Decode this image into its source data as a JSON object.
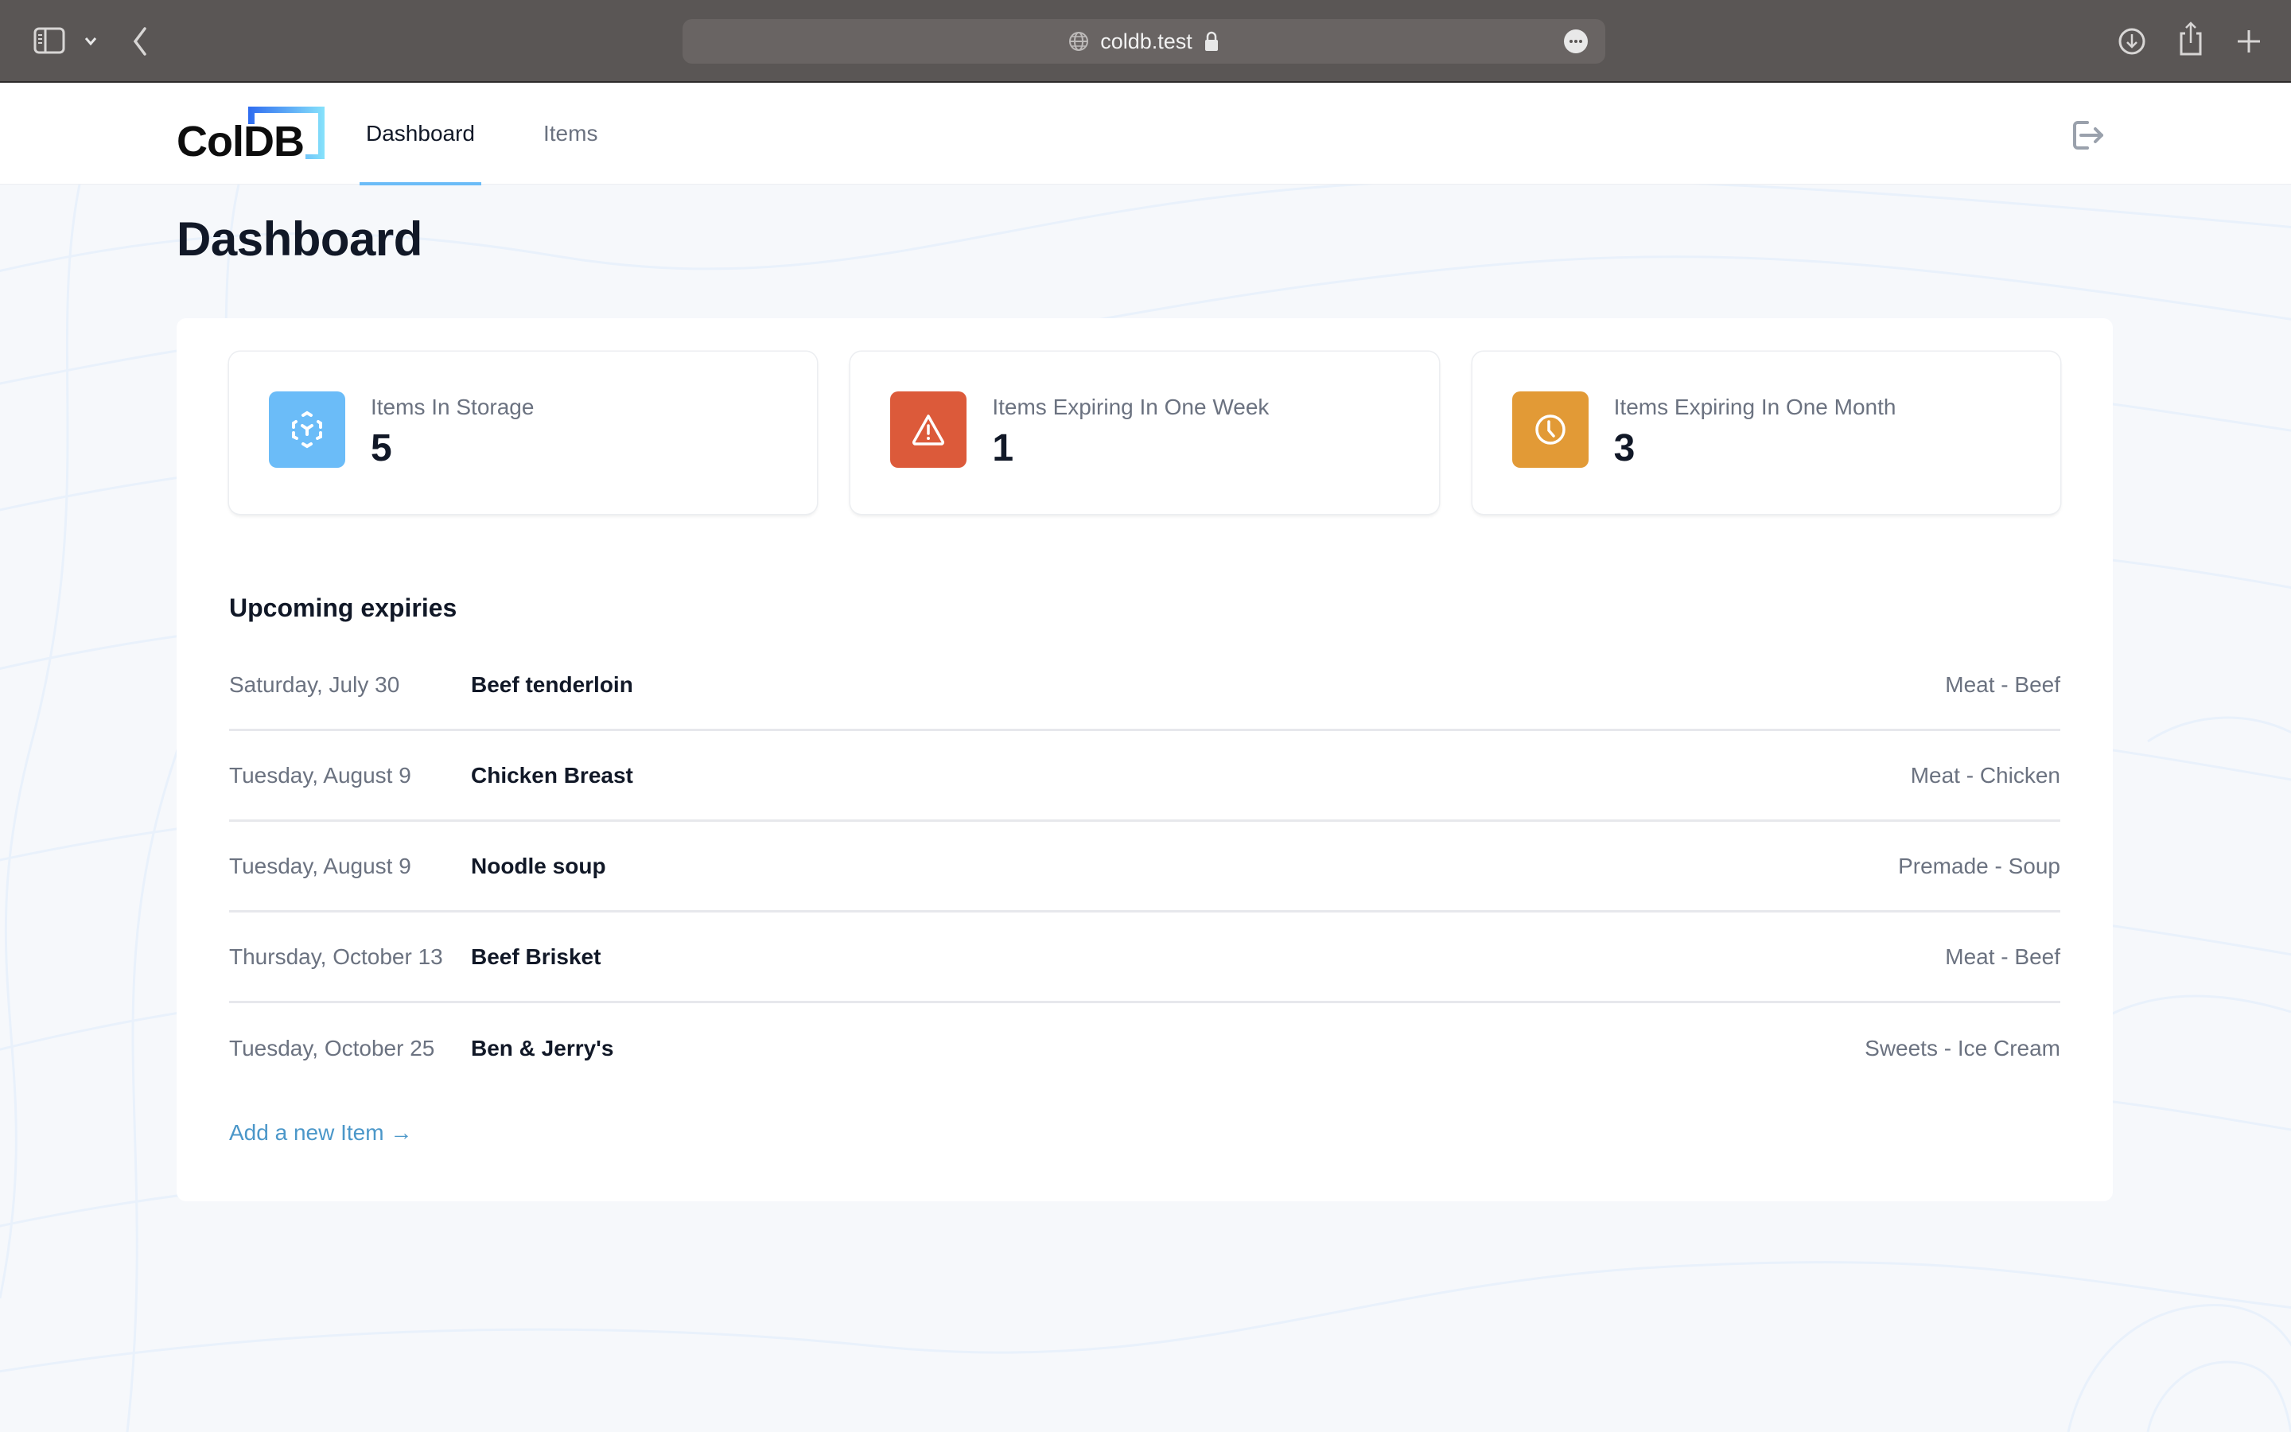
{
  "browser": {
    "url": "coldb.test",
    "icons": {
      "sidebar": "sidebar-icon",
      "chevron": "chevron-down-icon",
      "back": "back-icon",
      "globe": "globe-icon",
      "lock": "lock-icon",
      "more": "more-icon",
      "download": "download-icon",
      "share": "share-icon",
      "new_tab": "plus-icon"
    }
  },
  "header": {
    "logo_text": "ColDB",
    "nav": [
      {
        "label": "Dashboard",
        "active": true
      },
      {
        "label": "Items",
        "active": false
      }
    ],
    "logout_icon": "logout-icon"
  },
  "page": {
    "title": "Dashboard"
  },
  "stats": [
    {
      "label": "Items In Storage",
      "value": "5",
      "icon": "cube-icon",
      "color": "#6bbcf8"
    },
    {
      "label": "Items Expiring In One Week",
      "value": "1",
      "icon": "warning-icon",
      "color": "#dc5a3a"
    },
    {
      "label": "Items Expiring In One Month",
      "value": "3",
      "icon": "clock-icon",
      "color": "#e29a36"
    }
  ],
  "upcoming": {
    "title": "Upcoming expiries",
    "rows": [
      {
        "date": "Saturday, July 30",
        "name": "Beef tenderloin",
        "category": "Meat - Beef"
      },
      {
        "date": "Tuesday, August 9",
        "name": "Chicken Breast",
        "category": "Meat - Chicken"
      },
      {
        "date": "Tuesday, August 9",
        "name": "Noodle soup",
        "category": "Premade - Soup"
      },
      {
        "date": "Thursday, October 13",
        "name": "Beef Brisket",
        "category": "Meat - Beef"
      },
      {
        "date": "Tuesday, October 25",
        "name": "Ben & Jerry's",
        "category": "Sweets - Ice Cream"
      }
    ],
    "add_link": "Add a new Item →"
  },
  "colors": {
    "accent": "#6bbcf7",
    "link": "#4b97c9",
    "chrome": "#5a5655"
  }
}
